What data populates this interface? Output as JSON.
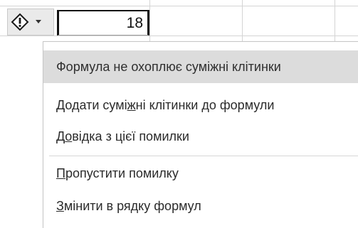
{
  "cell": {
    "value": "18"
  },
  "smart_tag": {
    "icon": "warning-diamond-icon",
    "dropdown_icon": "chevron-down-icon"
  },
  "menu": {
    "header": "Формула не охоплює суміжні клітинки",
    "items": [
      {
        "before": "Додати сумі",
        "accel": "ж",
        "after": "ні клітинки до формули"
      },
      {
        "before": "Д",
        "accel": "о",
        "after": "відка з цієї помилки"
      },
      {
        "before": "",
        "accel": "П",
        "after": "ропустити помилку"
      },
      {
        "before": "",
        "accel": "З",
        "after": "мінити в рядку формул"
      }
    ]
  }
}
